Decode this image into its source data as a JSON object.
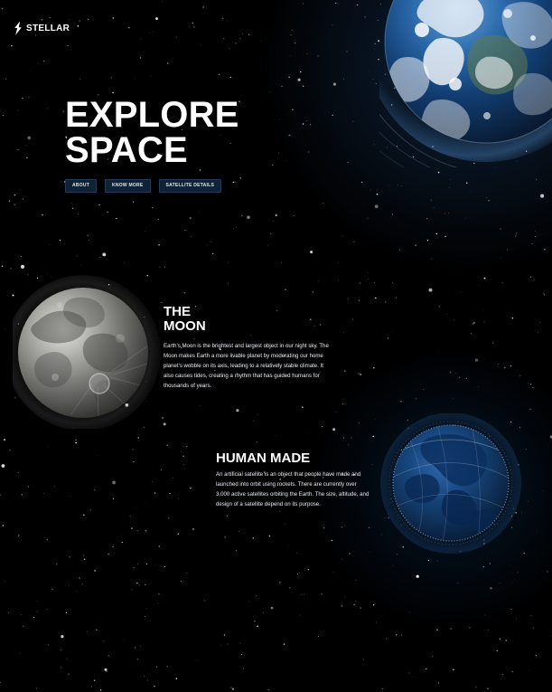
{
  "brand": {
    "name": "STELLAR"
  },
  "hero": {
    "title": "EXPLORE\nSPACE",
    "buttons": [
      {
        "label": "ABOUT"
      },
      {
        "label": "KNOW MORE"
      },
      {
        "label": "SATELLITE DETAILS"
      }
    ]
  },
  "moon": {
    "title": "THE\nMOON",
    "text": "Earth's Moon is the brightest and largest object in our night sky. The Moon makes Earth a more livable planet by moderating our home planet's wobble on its axis, leading to a relatively stable climate. It also causes tides, creating a rhythm that has guided humans for thousands of years."
  },
  "satellite": {
    "title": "HUMAN MADE",
    "text": "An artificial satellite is an object that people have made and launched into orbit using rockets. There are currently over 3,000 active satellites orbiting the Earth. The size, altitude, and design of a satellite depend on its purpose."
  },
  "icons": {
    "logo": "lightning-bolt-icon",
    "planet": "earth-image",
    "moon": "moon-image",
    "satellite_globe": "satellite-globe-image"
  },
  "colors": {
    "background": "#000000",
    "button_bg": "#0f2236",
    "button_border": "#223a57",
    "text": "#ffffff",
    "earth_glow": "#2c70bc"
  }
}
